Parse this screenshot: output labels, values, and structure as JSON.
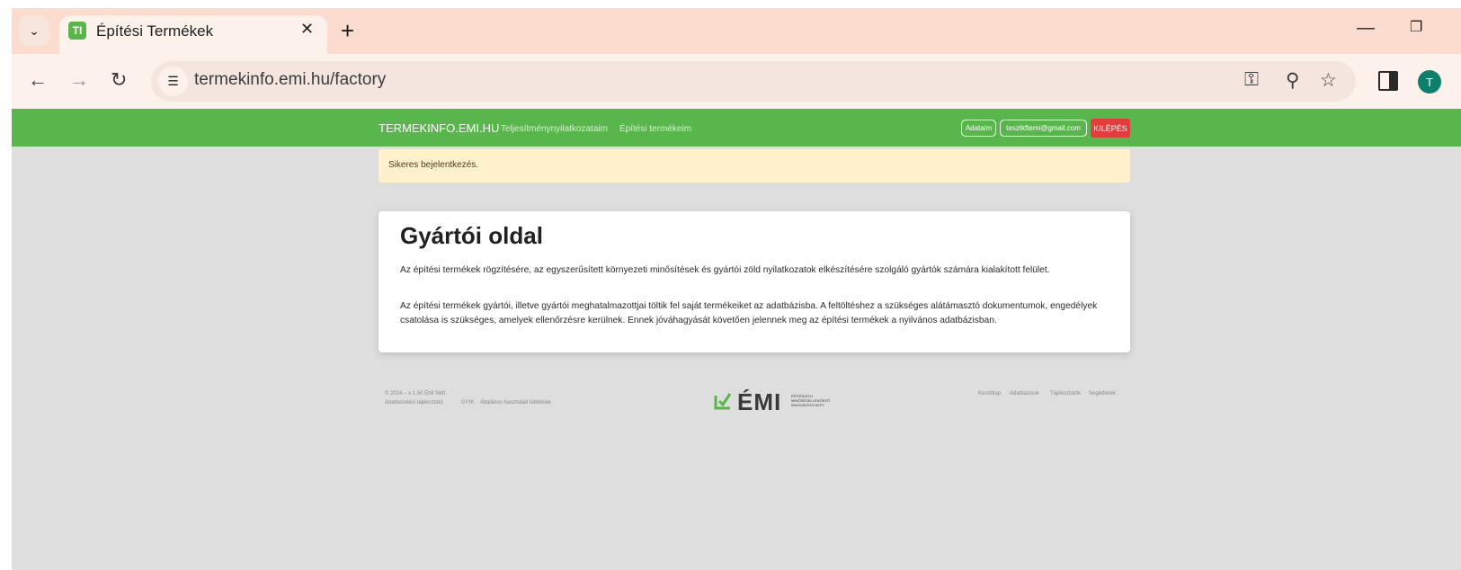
{
  "browser": {
    "tab_title": "Építési Termékek",
    "favicon_text": "TI",
    "url": "termekinfo.emi.hu/factory",
    "profile_initial": "T",
    "icons": [
      "chevron-down-icon",
      "close-icon",
      "plus-icon",
      "minimize-icon",
      "restore-icon",
      "back-icon",
      "forward-icon",
      "reload-icon",
      "site-info-icon",
      "password-key-icon",
      "zoom-icon",
      "star-icon",
      "side-panel-icon"
    ]
  },
  "navbar": {
    "brand": "TERMEKINFO.EMI.HU",
    "links": [
      "Teljesítménynyilatkozataim",
      "Építési termékeim"
    ],
    "my_data": "Adataim",
    "email": "tesztkftemi@gmail.com",
    "logout": "KILÉPÉS",
    "accent": "#58b64c"
  },
  "alert": {
    "text": "Sikeres bejelentkezés."
  },
  "main": {
    "title": "Gyártói oldal",
    "paragraph1": "Az építési termékek rögzítésére, az egyszerűsített környezeti minősítések és gyártói zöld nyilatkozatok elkészítésére szolgáló gyártók számára kialakított felület.",
    "paragraph2": "Az építési termékek gyártói, illetve gyártói meghatalmazottjai töltik fel saját termékeiket az adatbázisba. A feltöltéshez a szükséges alátámasztó dokumentumok, engedélyek csatolása is szükséges, amelyek ellenőrzésre kerülnek. Ennek jóváhagyását követően jelennek meg az építési termékek a nyilvános adatbázisban."
  },
  "footer": {
    "copyright": "© 2024 – v 1.50 ÉMI Nkft.",
    "left_links": [
      "Adatkezelési tájékoztató",
      "GYIK",
      "Általános használati feltételek"
    ],
    "logo_text": "ÉMI",
    "logo_sub": "ÉPÍTÉSÜGYI MINŐSÉGELLENŐRZŐ INNOVÁCIÓS NKFT.",
    "right_links": [
      "Kezdőlap",
      "Adatbázisok",
      "Tájékoztatók",
      "Segédletek"
    ]
  }
}
